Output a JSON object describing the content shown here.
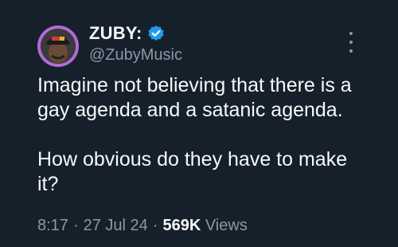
{
  "tweet": {
    "author": {
      "display_name": "ZUBY:",
      "handle": "@ZubyMusic",
      "verified": true,
      "avatar_icon": "user-avatar-icon"
    },
    "text": {
      "paragraph_1": "Imagine not believing that there is a gay agenda and a satanic agenda.",
      "paragraph_2": "How obvious do they have to make it?"
    },
    "meta": {
      "time": "8:17",
      "separator": "·",
      "date": "27 Jul 24",
      "views_count": "569K",
      "views_label": "Views"
    }
  },
  "colors": {
    "background": "#15202b",
    "text_primary": "#f7f9f9",
    "text_secondary": "#8b98a5",
    "verified_badge": "#1d9bf0",
    "avatar_ring": "#b26ad6"
  }
}
